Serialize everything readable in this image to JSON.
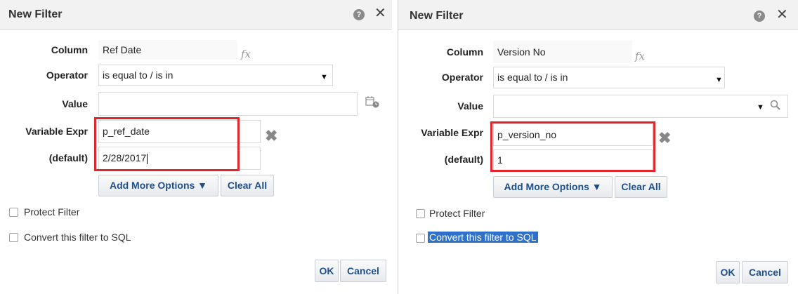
{
  "left": {
    "title": "New Filter",
    "help_glyph": "?",
    "close_glyph": "✕",
    "labels": {
      "column": "Column",
      "operator": "Operator",
      "value": "Value",
      "variable_expr": "Variable Expr",
      "default": "(default)"
    },
    "column_value": "Ref Date",
    "fx_label": "fx",
    "operator_value": "is equal to / is in",
    "value_value": "",
    "variable_expr_value": "p_ref_date",
    "default_value": "2/28/2017",
    "clear_glyph": "✖",
    "add_more_options": "Add More Options ▼",
    "clear_all": "Clear All",
    "protect_filter": "Protect Filter",
    "convert_sql": "Convert this filter to SQL",
    "ok": "OK",
    "cancel": "Cancel"
  },
  "right": {
    "title": "New Filter",
    "help_glyph": "?",
    "close_glyph": "✕",
    "labels": {
      "column": "Column",
      "operator": "Operator",
      "value": "Value",
      "variable_expr": "Variable Expr",
      "default": "(default)"
    },
    "column_value": "Version No",
    "fx_label": "fx",
    "operator_value": "is equal to / is in",
    "value_value": "",
    "variable_expr_value": "p_version_no",
    "default_value": "1",
    "clear_glyph": "✖",
    "add_more_options": "Add More Options ▼",
    "clear_all": "Clear All",
    "protect_filter": "Protect Filter",
    "convert_sql": "Convert this filter to SQL",
    "ok": "OK",
    "cancel": "Cancel"
  },
  "icons": {
    "dropdown": "triangle-down-icon",
    "calendar": "calendar-icon",
    "search": "magnifier-icon"
  },
  "colors": {
    "highlight_border": "#e0252d",
    "button_text": "#1f4f8a",
    "selection": "#2f71c9"
  }
}
